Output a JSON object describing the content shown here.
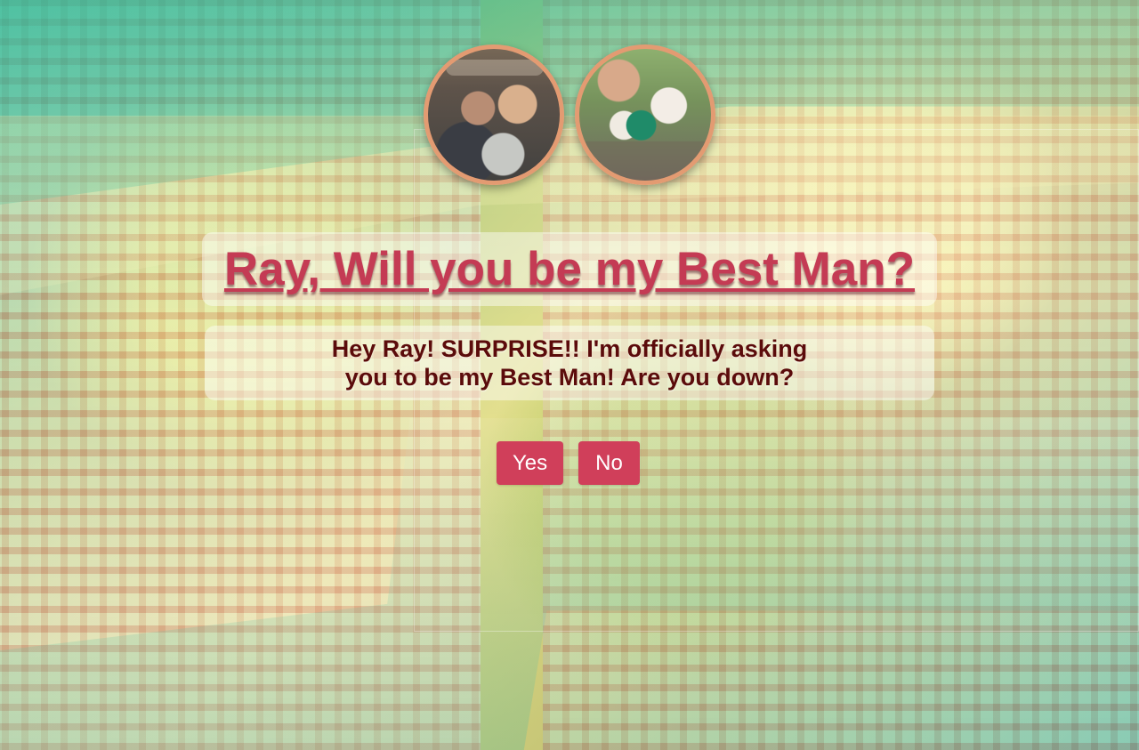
{
  "hero": {
    "title": "Ray, Will you be my Best Man?",
    "message": "Hey Ray! SURPRISE!! I'm officially asking you to be my Best Man! Are you down?"
  },
  "actions": {
    "yes_label": "Yes",
    "no_label": "No"
  },
  "colors": {
    "title": "#c43b54",
    "message": "#5b0b0b",
    "button": "#d03f5a",
    "avatar_border": "#e39b72"
  }
}
